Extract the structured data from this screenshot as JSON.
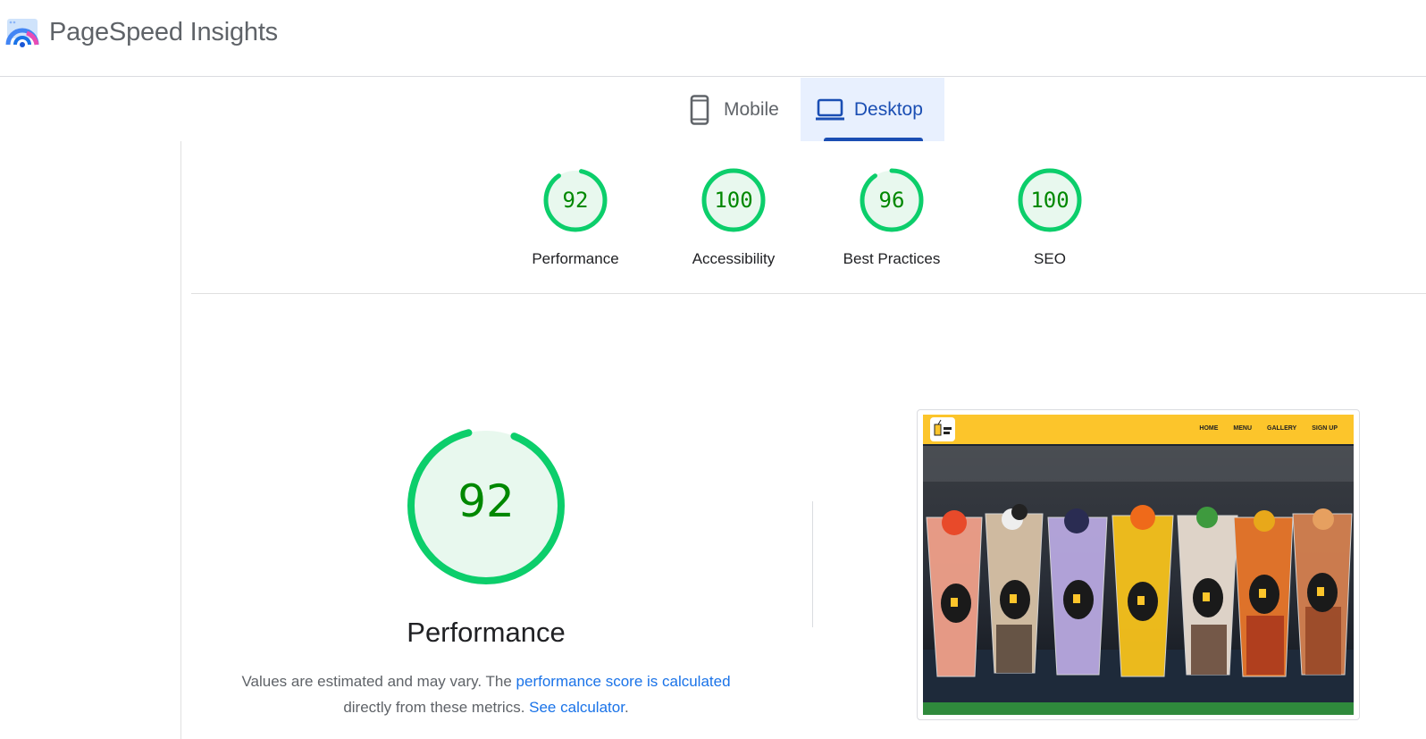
{
  "app": {
    "title": "PageSpeed Insights"
  },
  "tabs": [
    {
      "label": "Mobile",
      "icon": "phone-icon",
      "active": false
    },
    {
      "label": "Desktop",
      "icon": "laptop-icon",
      "active": true
    }
  ],
  "scores": [
    {
      "value": "92",
      "label": "Performance",
      "fraction": 0.92
    },
    {
      "value": "100",
      "label": "Accessibility",
      "fraction": 1.0
    },
    {
      "value": "96",
      "label": "Best Practices",
      "fraction": 0.96
    },
    {
      "value": "100",
      "label": "SEO",
      "fraction": 1.0
    }
  ],
  "performance": {
    "score": "92",
    "fraction": 0.92,
    "title": "Performance",
    "note_prefix": "Values are estimated and may vary. The ",
    "note_link1": "performance score is calculated",
    "note_middle": " directly from these metrics. ",
    "note_link2": "See calculator",
    "note_suffix": "."
  },
  "screenshot": {
    "nav_links": [
      "HOME",
      "MENU",
      "GALLERY",
      "SIGN UP"
    ]
  },
  "colors": {
    "pass_green": "#0cce6b",
    "pass_fill": "#e8f8ee",
    "pass_text": "#008800",
    "accent_blue": "#1a4eb3",
    "link_blue": "#1a73e8"
  }
}
